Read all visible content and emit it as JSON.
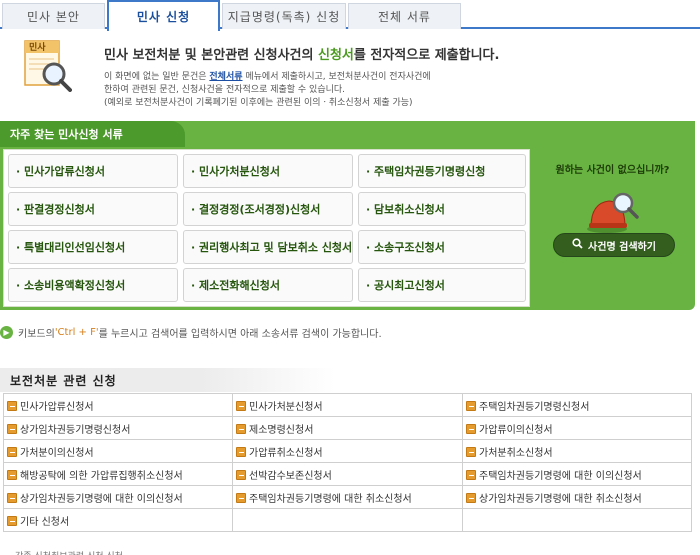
{
  "tabs": [
    "민사 본안",
    "민사 신청",
    "지급명령(독촉) 신청",
    "전체 서류"
  ],
  "active_tab": "민사 신청",
  "intro": {
    "icon_label": "민사",
    "headline_pre": "민사 보전처분 및 본안관련 신청사건의 ",
    "headline_highlight": "신청서",
    "headline_post": "를 전자적으로 제출합니다.",
    "desc_line1_pre": "이 화면에 없는 일반 문건은 ",
    "desc_link": "전체서류",
    "desc_line1_post": " 메뉴에서 제출하시고, 보전처분사건이 전자사건에",
    "desc_line2": "한하여 관련된 문건, 신청사건을 전자적으로 제출할 수 있습니다.",
    "desc_line3": "(예외로 보전처분사건이 기록폐기된 이후에는 관련된 이의ㆍ취소신청서 제출 가능)"
  },
  "favorites": {
    "title": "자주 찾는 민사신청 서류",
    "items": [
      "· 민사가압류신청서",
      "· 민사가처분신청서",
      "· 주택임차권등기명령신청",
      "· 판결경정신청서",
      "· 결정경정(조서경정)신청서",
      "· 담보취소신청서",
      "· 특별대리인선임신청서",
      "· 권리행사최고 및 담보취소 신청서",
      "· 소송구조신청서",
      "· 소송비용액확정신청서",
      "· 제소전화해신청서",
      "· 공시최고신청서"
    ],
    "side_question": "원하는 사건이 없으십니까?",
    "side_button": "사건명 검색하기"
  },
  "hint": {
    "pre": "키보드의 ",
    "key": "'Ctrl + F'",
    "post": "를 누르시고 검색어를 입력하시면 아래 소송서류 검색이 가능합니다."
  },
  "section": {
    "title": "보전처분 관련 신청",
    "rows": [
      [
        "민사가압류신청서",
        "민사가처분신청서",
        "주택임차권등기명령신청서"
      ],
      [
        "상가임차권등기명령신청서",
        "제소명령신청서",
        "가압류이의신청서"
      ],
      [
        "가처분이의신청서",
        "가압류취소신청서",
        "가처분취소신청서"
      ],
      [
        "해방공탁에 의한 가압류집행취소신청서",
        "선박감수보존신청서",
        "주택임차권등기명령에 대한 이의신청서"
      ],
      [
        "상가임차권등기명령에 대한 이의신청서",
        "주택임차권등기명령에 대한 취소신청서",
        "상가임차권등기명령에 대한 취소신청서"
      ],
      [
        "기타 신청서",
        "",
        ""
      ]
    ]
  },
  "bottom_cut": "각종 신청취보관련 신청 신청"
}
